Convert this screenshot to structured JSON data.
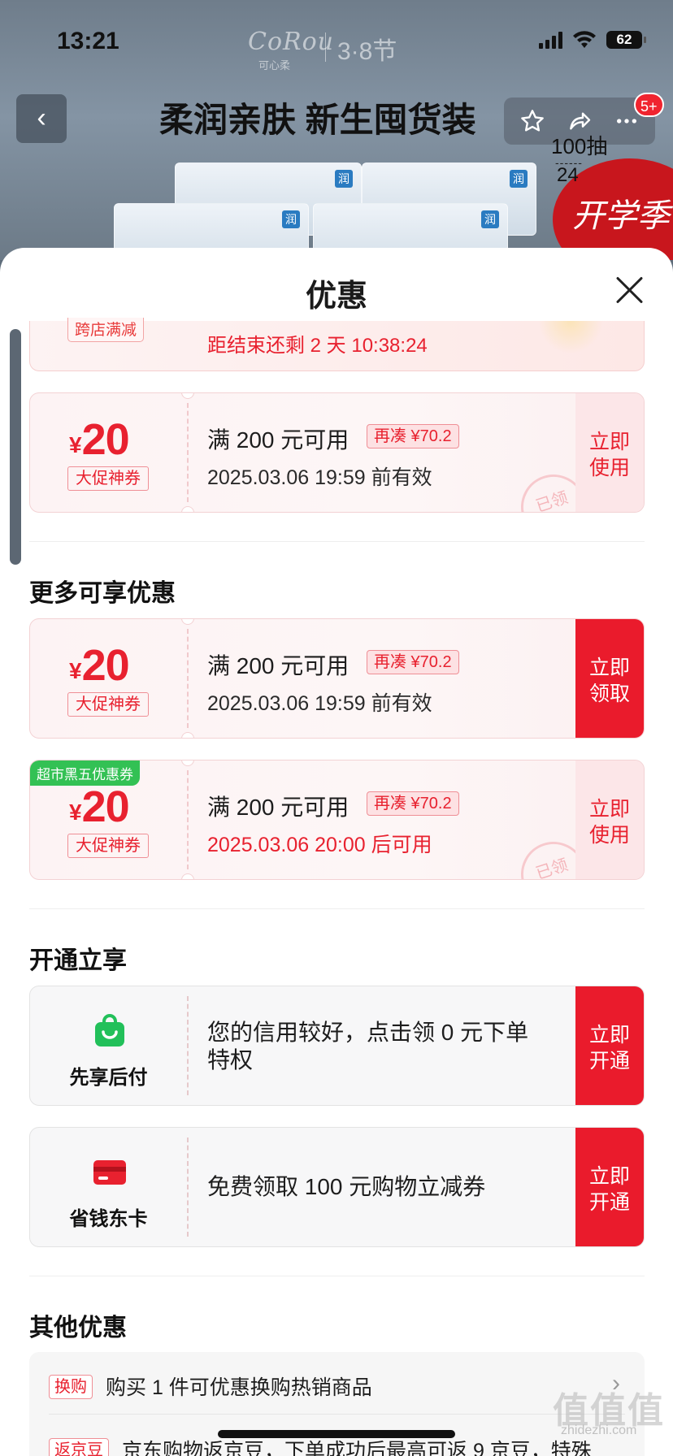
{
  "status_bar": {
    "time": "13:21",
    "battery": "62"
  },
  "backdrop": {
    "brand": "CoRou",
    "brand_sub": "可心柔",
    "event": "3·8节",
    "package_mark": "润",
    "promo_stamp": "开学季"
  },
  "nav": {
    "back_glyph": "‹",
    "title": "柔润亲肤 新生囤货装",
    "badge": "5+",
    "pack_label": "100抽",
    "pack_dash": "------",
    "pack_num": "24"
  },
  "sheet": {
    "title": "优惠",
    "partial": {
      "tag": "跨店满减",
      "countdown": "距结束还剩 2 天 10:38:24"
    },
    "top_coupon": {
      "currency": "¥",
      "amount": "20",
      "type": "大促神券",
      "condition": "满 200 元可用",
      "extra": "再凑 ¥70.2",
      "validity": "2025.03.06 19:59 前有效",
      "button": "立即\n使用",
      "stamp": "已领"
    },
    "more_section": {
      "title": "更多可享优惠",
      "coupons": [
        {
          "currency": "¥",
          "amount": "20",
          "type": "大促神券",
          "condition": "满 200 元可用",
          "extra": "再凑 ¥70.2",
          "validity": "2025.03.06 19:59 前有效",
          "button": "立即\n领取"
        },
        {
          "tag": "超市黑五优惠券",
          "currency": "¥",
          "amount": "20",
          "type": "大促神券",
          "condition": "满 200 元可用",
          "extra": "再凑 ¥70.2",
          "validity": "2025.03.06 20:00 后可用",
          "button": "立即\n使用",
          "stamp": "已领"
        }
      ]
    },
    "open_section": {
      "title": "开通立享",
      "cards": [
        {
          "label": "先享后付",
          "desc": "您的信用较好，点击领 0 元下单特权",
          "button": "立即\n开通"
        },
        {
          "label": "省钱东卡",
          "desc": "免费领取 100 元购物立减券",
          "button": "立即\n开通"
        }
      ]
    },
    "other_section": {
      "title": "其他优惠",
      "rows": [
        {
          "tag": "换购",
          "text": "购买 1 件可优惠换购热销商品"
        },
        {
          "tag": "返京豆",
          "text": "京东购物返京豆，下单成功后最高可返 9 京豆，特殊"
        }
      ]
    }
  },
  "watermark": {
    "text": "值值值",
    "url": "zhidezhi.com"
  },
  "colors": {
    "accent_red": "#ea1b2c",
    "coupon_bg": "#fdf3f4",
    "green_tag": "#33c154",
    "xianxiang_green": "#22c05a",
    "dongka_red": "#e8212f"
  }
}
